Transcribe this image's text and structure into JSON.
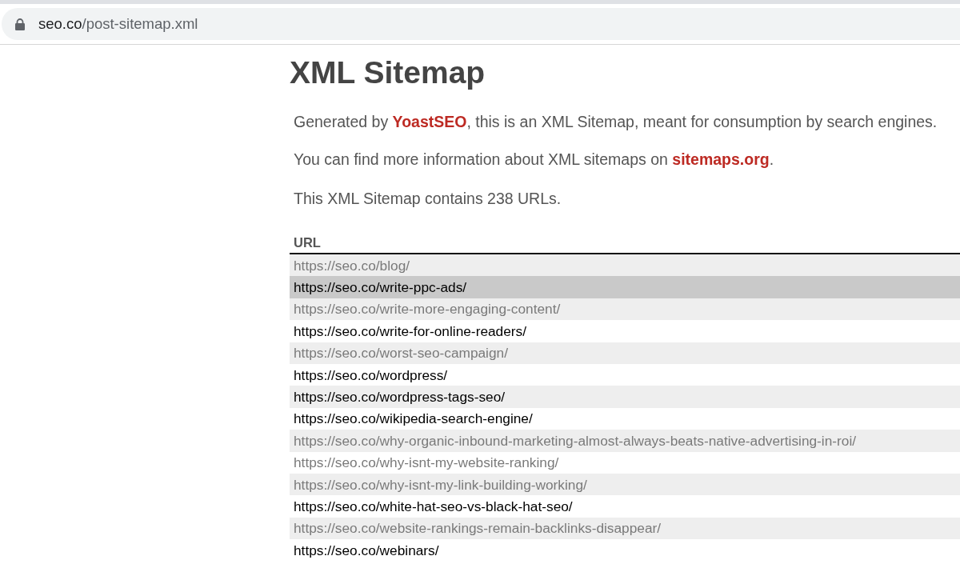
{
  "browser": {
    "address_bar": {
      "secure": true,
      "host": "seo.co",
      "path": "/post-sitemap.xml"
    }
  },
  "page": {
    "title": "XML Sitemap",
    "paragraphs": [
      [
        {
          "kind": "text",
          "text": "Generated by "
        },
        {
          "kind": "link",
          "text": "YoastSEO"
        },
        {
          "kind": "text",
          "text": ", this is an XML Sitemap, meant for consumption by search engines."
        }
      ],
      [
        {
          "kind": "text",
          "text": "You can find more information about XML sitemaps on "
        },
        {
          "kind": "link",
          "text": "sitemaps.org"
        },
        {
          "kind": "text",
          "text": "."
        }
      ],
      [
        {
          "kind": "text",
          "text": "This XML Sitemap contains 238 URLs."
        }
      ]
    ],
    "table": {
      "columns": [
        "URL"
      ],
      "rows": [
        {
          "url": "https://seo.co/blog/",
          "visited": true,
          "highlighted": false
        },
        {
          "url": "https://seo.co/write-ppc-ads/",
          "visited": false,
          "highlighted": true
        },
        {
          "url": "https://seo.co/write-more-engaging-content/",
          "visited": true,
          "highlighted": false
        },
        {
          "url": "https://seo.co/write-for-online-readers/",
          "visited": false,
          "highlighted": false
        },
        {
          "url": "https://seo.co/worst-seo-campaign/",
          "visited": true,
          "highlighted": false
        },
        {
          "url": "https://seo.co/wordpress/",
          "visited": false,
          "highlighted": false
        },
        {
          "url": "https://seo.co/wordpress-tags-seo/",
          "visited": false,
          "highlighted": false
        },
        {
          "url": "https://seo.co/wikipedia-search-engine/",
          "visited": false,
          "highlighted": false
        },
        {
          "url": "https://seo.co/why-organic-inbound-marketing-almost-always-beats-native-advertising-in-roi/",
          "visited": true,
          "highlighted": false
        },
        {
          "url": "https://seo.co/why-isnt-my-website-ranking/",
          "visited": true,
          "highlighted": false
        },
        {
          "url": "https://seo.co/why-isnt-my-link-building-working/",
          "visited": true,
          "highlighted": false
        },
        {
          "url": "https://seo.co/white-hat-seo-vs-black-hat-seo/",
          "visited": false,
          "highlighted": false
        },
        {
          "url": "https://seo.co/website-rankings-remain-backlinks-disappear/",
          "visited": true,
          "highlighted": false
        },
        {
          "url": "https://seo.co/webinars/",
          "visited": false,
          "highlighted": false
        }
      ]
    }
  }
}
